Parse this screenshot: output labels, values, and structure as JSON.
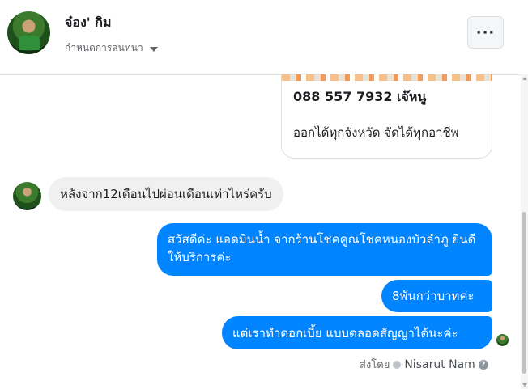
{
  "header": {
    "name": "จ๋อง' กิม",
    "subtitle": "กำหนดการสนทนา",
    "menu_icon": "more-horizontal-icon",
    "menu_label": "···"
  },
  "card": {
    "phone": "088 557 7932 เจ๊หนู",
    "desc": "ออกได้ทุกจังหวัด จัดได้ทุกอาชีพ"
  },
  "messages": {
    "incoming": "หลังจาก12เดือนไปผ่อนเดือนเท่าไหร่ครับ",
    "outgoing": [
      "สวัสดีค่ะ แอดมินน้ำ จากร้านโชคคูณโชคหนองบัวลำภู ยินดีให้บริการค่ะ",
      "8พันกว่าบาทค่ะ",
      "แต่เราทำดอกเบี้ย แบบดลอดสัญญาได้นะค่ะ"
    ]
  },
  "footer": {
    "sent_by_label": "ส่งโดย",
    "sender": "Nisarut Nam",
    "help_glyph": "?"
  },
  "colors": {
    "outgoing_bubble": "#0084ff",
    "incoming_bubble": "#f1f0f0"
  }
}
